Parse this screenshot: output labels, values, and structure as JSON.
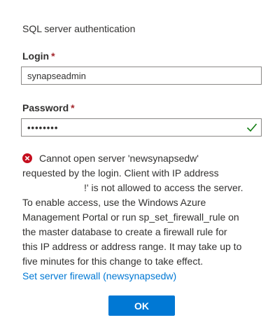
{
  "section_title": "SQL server authentication",
  "login": {
    "label": "Login",
    "required_marker": "*",
    "value": "synapseadmin"
  },
  "password": {
    "label": "Password",
    "required_marker": "*",
    "masked_value": "••••••••",
    "validation_icon": "check-icon",
    "validation_color": "#107c10"
  },
  "error": {
    "icon": "error-circle-icon",
    "icon_color": "#c50f1f",
    "lines": [
      "Cannot open server 'newsynapsedw'",
      "requested by the login. Client with IP address",
      "!' is not allowed to access the server.",
      "To enable access, use the Windows Azure",
      "Management Portal or run sp_set_firewall_rule on",
      "the master database to create a firewall rule for",
      "this IP address or address range. It may take up to",
      "five minutes for this change to take effect."
    ]
  },
  "firewall_link": "Set server firewall (newsynapsedw)",
  "ok_button": "OK",
  "colors": {
    "accent": "#0078d4",
    "required": "#a4262c",
    "text": "#323130",
    "input_border": "#8a8886"
  }
}
